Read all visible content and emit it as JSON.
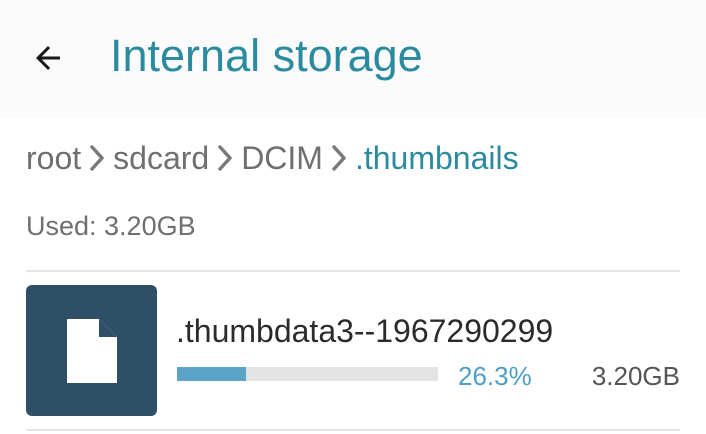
{
  "app_bar": {
    "back_icon": "arrow-left-icon",
    "title": "Internal storage"
  },
  "breadcrumb": {
    "separator_icon": "chevron-right-icon",
    "items": [
      {
        "label": "root"
      },
      {
        "label": "sdcard"
      },
      {
        "label": "DCIM"
      },
      {
        "label": ".thumbnails"
      }
    ]
  },
  "storage": {
    "used_text": "Used: 3.20GB"
  },
  "files": [
    {
      "icon": "file-icon",
      "name": ".thumbdata3--1967290299",
      "usage_fraction": 0.263,
      "percent_text": "26.3%",
      "size": "3.20GB"
    }
  ],
  "colors": {
    "accent": "#2a8ba0",
    "thumb_background": "#2f4f67",
    "progress_fill": "#5ba3c7",
    "progress_track": "#e3e3e3",
    "percent_text": "#4e9fc4"
  }
}
